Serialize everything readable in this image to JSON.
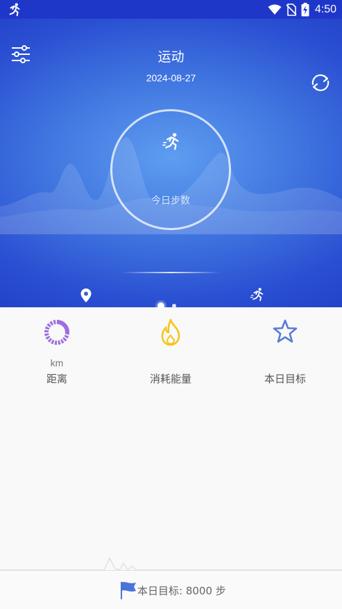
{
  "status_bar": {
    "time": "4:50",
    "icons": [
      "running-notification-icon",
      "wifi-icon",
      "no-sim-icon",
      "battery-charging-icon"
    ]
  },
  "header": {
    "title": "运动",
    "date": "2024-08-27",
    "menu_icon": "settings-sliders-icon",
    "sync_icon": "sync-icon"
  },
  "ring": {
    "label": "今日步数",
    "icon": "runner-icon"
  },
  "pager": {
    "pages": 2,
    "active_index": 0
  },
  "stats": [
    {
      "unit": "km",
      "label": "距离",
      "icon": "distance-ring-icon",
      "color": "#9c6fe0"
    },
    {
      "unit": "",
      "label": "消耗能量",
      "icon": "flame-icon",
      "color": "#f5c518"
    },
    {
      "unit": "",
      "label": "本日目标",
      "icon": "star-icon",
      "color": "#5b7bd6"
    }
  ],
  "goal": {
    "text": "本日目标: 8000 步",
    "icon": "flag-icon"
  },
  "colors": {
    "primary": "#2344c8",
    "accent_purple": "#9c6fe0",
    "accent_yellow": "#f5c518",
    "accent_blue": "#5b7bd6"
  }
}
